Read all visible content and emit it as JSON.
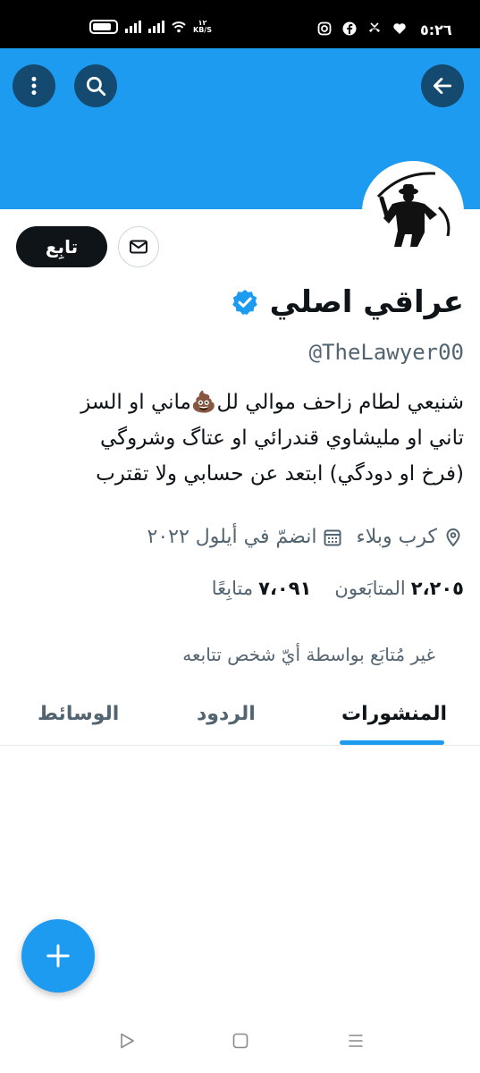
{
  "status_bar": {
    "time": "٥:٢٦",
    "speed_value": "١٢",
    "speed_unit": "KB/S"
  },
  "header": {
    "back_icon": "arrow-right-icon",
    "search_icon": "search-icon",
    "more_icon": "more-vertical-icon",
    "banner_color": "#1d9bf0"
  },
  "profile": {
    "display_name": "عراقي اصلي",
    "verified": true,
    "handle": "@TheLawyer00",
    "follow_label": "تابِع",
    "bio_lines": [
      "شنيعي لطام زاحف موالي لل💩ماني او السز",
      "تاني او مليشاوي قندرائي او عتاگ وشروگي",
      "(فرخ او دودگي) ابتعد عن حسابي ولا تقترب"
    ],
    "location": "كرب وبلاء",
    "joined": "انضمّ في أيلول ٢٠٢٢",
    "following_count": "٢،٢٠٥",
    "following_label": "المتابَعون",
    "followers_count": "٧،٠٩١",
    "followers_label": "متابِعًا",
    "not_followed_note": "غير مُتابَع بواسطة أيّ شخص تتابعه"
  },
  "tabs": [
    {
      "label": "المنشورات",
      "active": true
    },
    {
      "label": "الردود",
      "active": false
    },
    {
      "label": "الوسائط",
      "active": false
    }
  ],
  "fab": {
    "icon": "plus-icon"
  },
  "accent_color": "#1d9bf0"
}
